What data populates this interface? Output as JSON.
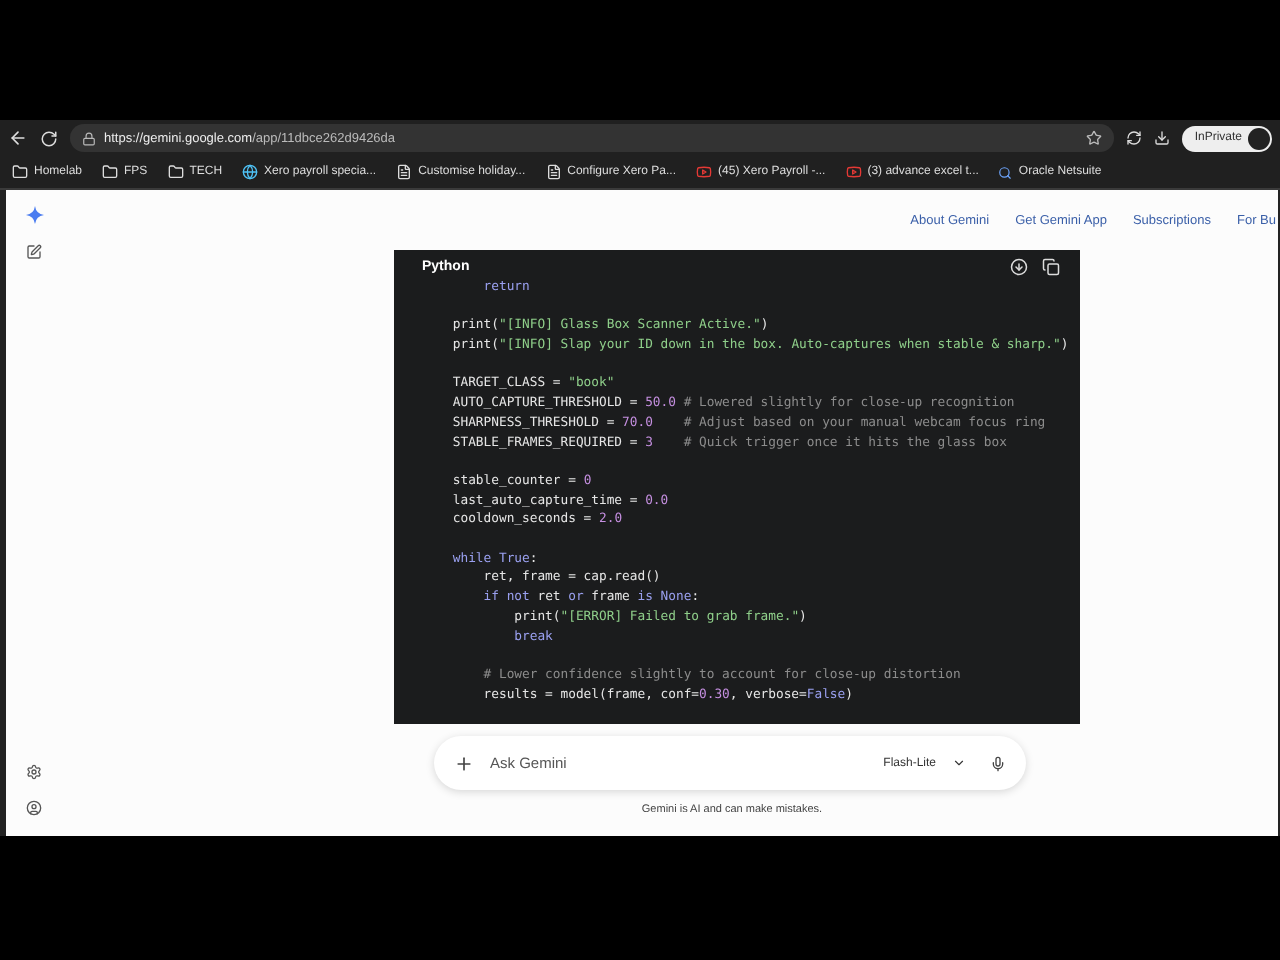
{
  "browser": {
    "url_host": "https://gemini.google.com",
    "url_path": "/app/11dbce262d9426da",
    "profile": "InPrivate"
  },
  "bookmarks": [
    {
      "label": "Homelab",
      "kind": "folder"
    },
    {
      "label": "FPS",
      "kind": "folder"
    },
    {
      "label": "TECH",
      "kind": "folder"
    },
    {
      "label": "Xero payroll specia...",
      "kind": "globe"
    },
    {
      "label": "Customise holiday...",
      "kind": "page"
    },
    {
      "label": "Configure Xero Pa...",
      "kind": "page"
    },
    {
      "label": "(45) Xero Payroll -...",
      "kind": "video"
    },
    {
      "label": "(3) advance excel t...",
      "kind": "video"
    },
    {
      "label": "Oracle Netsuite",
      "kind": "search"
    }
  ],
  "nav": [
    "About Gemini",
    "Get Gemini App",
    "Subscriptions",
    "For Bu"
  ],
  "code_block": {
    "language": "Python",
    "blocks": [
      {
        "lines": [
          [
            {
              "t": "        return",
              "kind": "keyword"
            }
          ]
        ]
      },
      {
        "lines": [
          [
            {
              "t": "    print(",
              "kind": "plain"
            },
            {
              "t": "\"[INFO] Glass Box Scanner Active.\"",
              "kind": "string"
            },
            {
              "t": ")",
              "kind": "plain"
            }
          ],
          [
            {
              "t": "    print(",
              "kind": "plain"
            },
            {
              "t": "\"[INFO] Slap your ID down in the box. Auto-captures when stable & sharp.\"",
              "kind": "string"
            },
            {
              "t": ")",
              "kind": "plain"
            }
          ]
        ]
      },
      {
        "lines": [
          [
            {
              "t": "    TARGET_CLASS = ",
              "kind": "plain"
            },
            {
              "t": "\"book\"",
              "kind": "string"
            }
          ],
          [
            {
              "t": "    AUTO_CAPTURE_THRESHOLD = ",
              "kind": "plain"
            },
            {
              "t": "50.0",
              "kind": "number"
            },
            {
              "t": " # Lowered slightly for close-up recognition",
              "kind": "comment"
            }
          ],
          [
            {
              "t": "    SHARPNESS_THRESHOLD = ",
              "kind": "plain"
            },
            {
              "t": "70.0",
              "kind": "number"
            },
            {
              "t": "    # Adjust based on your manual webcam focus ring",
              "kind": "comment"
            }
          ],
          [
            {
              "t": "    STABLE_FRAMES_REQUIRED = ",
              "kind": "plain"
            },
            {
              "t": "3",
              "kind": "number"
            },
            {
              "t": "    # Quick trigger once it hits the glass box",
              "kind": "comment"
            }
          ]
        ]
      },
      {
        "lines": [
          [
            {
              "t": "    stable_counter = ",
              "kind": "plain"
            },
            {
              "t": "0",
              "kind": "number"
            }
          ],
          [
            {
              "t": "    last_auto_capture_time = ",
              "kind": "plain"
            },
            {
              "t": "0.0",
              "kind": "number"
            }
          ],
          [
            {
              "t": "    cooldown_seconds = ",
              "kind": "plain"
            },
            {
              "t": "2.0",
              "kind": "number"
            }
          ]
        ]
      },
      {
        "lines": [
          [
            {
              "t": "    while ",
              "kind": "keyword"
            },
            {
              "t": "True",
              "kind": "keyword"
            },
            {
              "t": ":",
              "kind": "plain"
            }
          ],
          [
            {
              "t": "        ret, frame = cap.read()",
              "kind": "plain"
            }
          ],
          [
            {
              "t": "        if not ",
              "kind": "keyword"
            },
            {
              "t": "ret ",
              "kind": "plain"
            },
            {
              "t": "or ",
              "kind": "keyword"
            },
            {
              "t": "frame ",
              "kind": "plain"
            },
            {
              "t": "is None",
              "kind": "keyword"
            },
            {
              "t": ":",
              "kind": "plain"
            }
          ],
          [
            {
              "t": "            print(",
              "kind": "plain"
            },
            {
              "t": "\"[ERROR] Failed to grab frame.\"",
              "kind": "string"
            },
            {
              "t": ")",
              "kind": "plain"
            }
          ],
          [
            {
              "t": "            break",
              "kind": "keyword"
            }
          ]
        ]
      },
      {
        "lines": [
          [
            {
              "t": "        # Lower confidence slightly to account for close-up distortion",
              "kind": "comment"
            }
          ],
          [
            {
              "t": "        results = model(frame, conf=",
              "kind": "plain"
            },
            {
              "t": "0.30",
              "kind": "number"
            },
            {
              "t": ", verbose=",
              "kind": "plain"
            },
            {
              "t": "False",
              "kind": "keyword"
            },
            {
              "t": ")",
              "kind": "plain"
            }
          ]
        ]
      }
    ]
  },
  "prompt": {
    "placeholder": "Ask Gemini",
    "model": "Flash-Lite"
  },
  "disclaimer": "Gemini is AI and can make mistakes."
}
